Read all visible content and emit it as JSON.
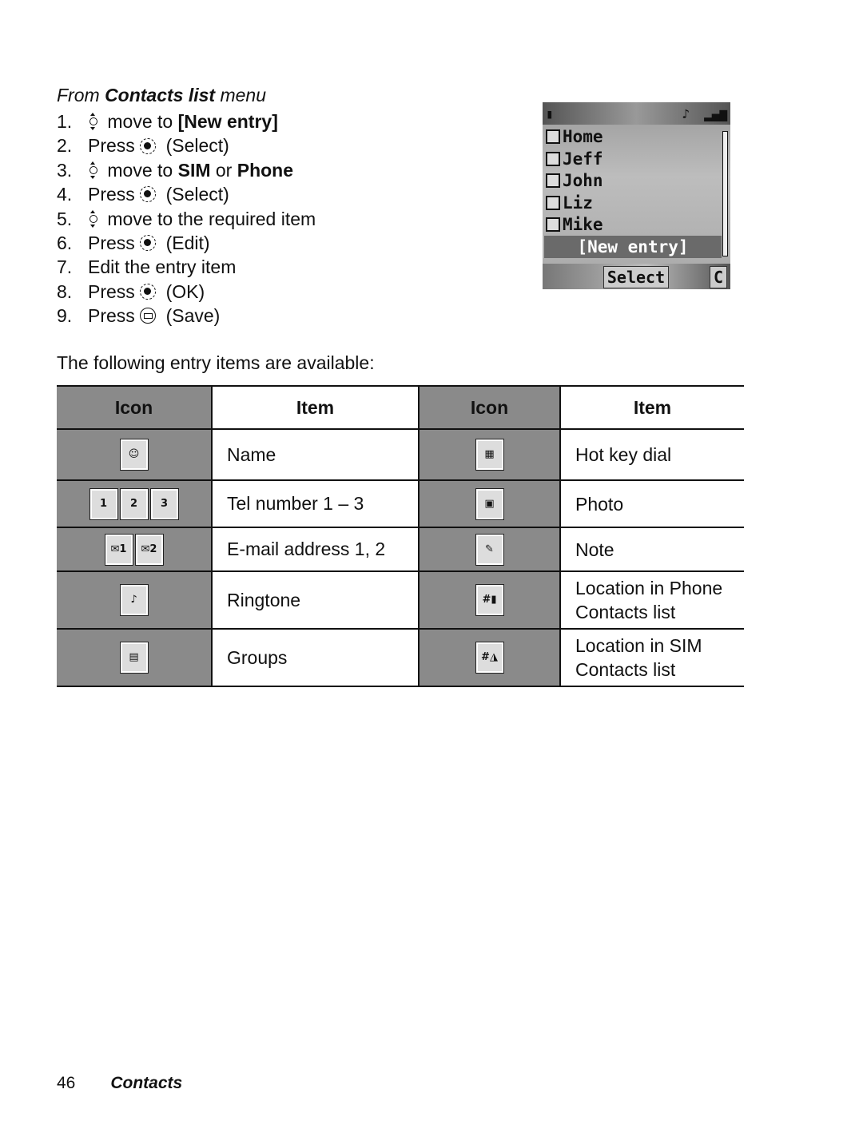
{
  "heading": {
    "prefix": "From ",
    "bold": "Contacts list",
    "suffix": " menu"
  },
  "steps": [
    {
      "num": "1.",
      "icon": "navigation-key-icon",
      "pre": "",
      "text": " move to ",
      "bold": "[New entry]",
      "post": ""
    },
    {
      "num": "2.",
      "icon": "select-key-icon",
      "pre": "Press ",
      "text": " (Select)",
      "bold": "",
      "post": ""
    },
    {
      "num": "3.",
      "icon": "navigation-key-icon",
      "pre": "",
      "text": " move to ",
      "bold": "SIM",
      "post": " or ",
      "bold2": "Phone"
    },
    {
      "num": "4.",
      "icon": "select-key-icon",
      "pre": "Press ",
      "text": " (Select)",
      "bold": "",
      "post": ""
    },
    {
      "num": "5.",
      "icon": "navigation-key-icon",
      "pre": "",
      "text": " move to the required item",
      "bold": "",
      "post": ""
    },
    {
      "num": "6.",
      "icon": "select-key-icon",
      "pre": "Press ",
      "text": " (Edit)",
      "bold": "",
      "post": ""
    },
    {
      "num": "7.",
      "icon": "",
      "pre": "Edit the entry item",
      "text": "",
      "bold": "",
      "post": ""
    },
    {
      "num": "8.",
      "icon": "select-key-icon",
      "pre": "Press ",
      "text": " (OK)",
      "bold": "",
      "post": ""
    },
    {
      "num": "9.",
      "icon": "soft-key-icon",
      "pre": "Press ",
      "text": " (Save)",
      "bold": "",
      "post": ""
    }
  ],
  "phone": {
    "contacts": [
      "Home",
      "Jeff",
      "John",
      "Liz",
      "Mike"
    ],
    "new_entry": "[New entry]",
    "softkey": "Select",
    "clear": "C"
  },
  "paragraph": "The following entry items are available:",
  "table": {
    "headers": [
      "Icon",
      "Item",
      "Icon",
      "Item"
    ],
    "rows": [
      {
        "left_icons": [
          "name-icon"
        ],
        "left": "Name",
        "right_icon": "hot-key-dial-icon",
        "right": "Hot key dial"
      },
      {
        "left_icons": [
          "tel-1-icon",
          "tel-2-icon",
          "tel-3-icon"
        ],
        "left": "Tel number 1 – 3",
        "right_icon": "photo-icon",
        "right": "Photo"
      },
      {
        "left_icons": [
          "email-1-icon",
          "email-2-icon"
        ],
        "left": "E-mail address 1, 2",
        "right_icon": "note-icon",
        "right": "Note"
      },
      {
        "left_icons": [
          "ringtone-icon"
        ],
        "left": "Ringtone",
        "right_icon": "phone-location-icon",
        "right": "Location in Phone Contacts list"
      },
      {
        "left_icons": [
          "groups-icon"
        ],
        "left": "Groups",
        "right_icon": "sim-location-icon",
        "right": "Location in SIM Contacts list"
      }
    ]
  },
  "footer": {
    "page": "46",
    "section": "Contacts"
  }
}
